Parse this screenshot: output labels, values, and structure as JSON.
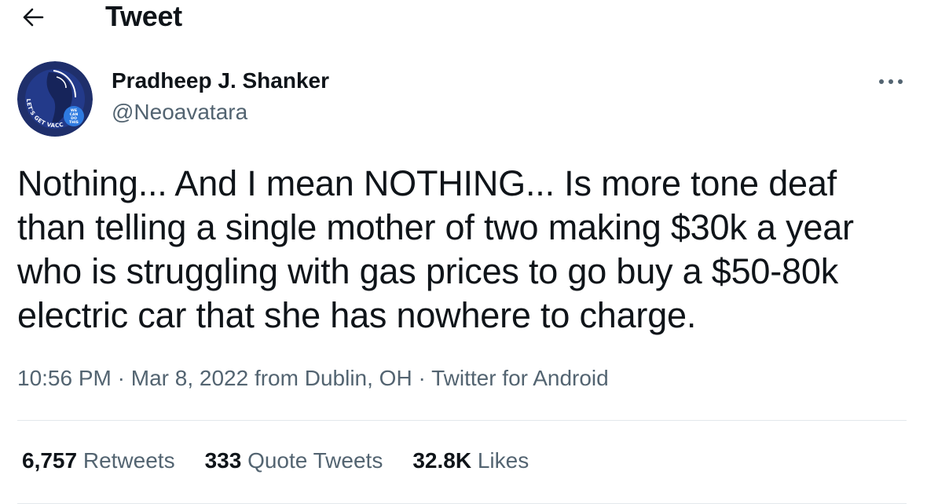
{
  "header": {
    "back_icon": "arrow-left-icon",
    "title": "Tweet"
  },
  "author": {
    "name": "Pradheep J. Shanker",
    "handle": "@Neoavatara",
    "avatar": {
      "ring_text": "LET'S GET VACCINATED",
      "badge_text": "WE CAN DO THIS"
    }
  },
  "more_icon": "more-horizontal-icon",
  "tweet": {
    "text": "Nothing... And I mean NOTHING... Is more tone deaf\nthan telling a single mother of two making $30k a year\nwho is struggling with gas prices to go buy a $50-80k\nelectric car that she has nowhere to charge.",
    "time": "10:56 PM",
    "date": "Mar 8, 2022",
    "location_prefix": " from ",
    "location": "Dublin, OH",
    "separator": " · ",
    "source": "Twitter for Android"
  },
  "stats": {
    "retweets": {
      "count": "6,757",
      "label": "Retweets"
    },
    "quotes": {
      "count": "333",
      "label": "Quote Tweets"
    },
    "likes": {
      "count": "32.8K",
      "label": "Likes"
    }
  },
  "colors": {
    "text_primary": "#0f1419",
    "text_secondary": "#536471",
    "divider": "#e3e8ec",
    "avatar_navy": "#1f2f6b",
    "avatar_blue": "#2e7ae0"
  }
}
